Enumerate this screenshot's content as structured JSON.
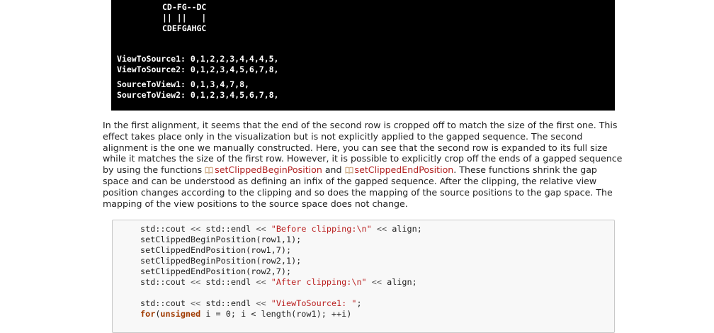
{
  "console": {
    "alignment_lines": [
      "CD-FG--DC",
      "|| ||   |",
      "CDEFGAHGC"
    ],
    "view_to_source": [
      "ViewToSource1: 0,1,2,2,3,4,4,4,5,",
      "ViewToSource2: 0,1,2,3,4,5,6,7,8,"
    ],
    "source_to_view": [
      "SourceToView1: 0,1,3,4,7,8,",
      "SourceToView2: 0,1,2,3,4,5,6,7,8,"
    ]
  },
  "prose": {
    "part1": "In the first alignment, it seems that the end of the second row is cropped off to match the size of the first one. This effect takes place only in the visualization but is not explicitly applied to the gapped sequence. The second alignment is the one we manually constructed. Here, you can see that the second row is expanded to its full size while it matches the size of the first row. However, it is possible to explicitly crop off the ends of a gapped sequence by using the functions ",
    "link1": "setClippedBeginPosition",
    "and": " and ",
    "link2": "setClippedEndPosition",
    "part2": ". These functions shrink the gap space and can be understood as defining an infix of the gapped sequence. After the clipping, the relative view position changes according to the clipping and so does the mapping of the source positions to the gap space. The mapping of the view positions to the source space does not change."
  },
  "code": {
    "l1_a": "std::cout ",
    "l1_op1": "<<",
    "l1_b": " std::endl ",
    "l1_op2": "<<",
    "l1_str": "\"Before clipping:\\n\"",
    "l1_op3": "<<",
    "l1_c": " align;",
    "l2": "setClippedBeginPosition(row1,1);",
    "l3": "setClippedEndPosition(row1,7);",
    "l4": "setClippedBeginPosition(row2,1);",
    "l5": "setClippedEndPosition(row2,7);",
    "l6_a": "std::cout ",
    "l6_op1": "<<",
    "l6_b": " std::endl ",
    "l6_op2": "<<",
    "l6_str": "\"After clipping:\\n\"",
    "l6_op3": "<<",
    "l6_c": " align;",
    "l7_a": "std::cout ",
    "l7_op1": "<<",
    "l7_b": " std::endl ",
    "l7_op2": "<<",
    "l7_str": "\"ViewToSource1: \"",
    "l7_c": ";",
    "l8_kw1": "for",
    "l8_a": "(",
    "l8_kw2": "unsigned",
    "l8_b": " i = 0; i < length(row1); ++i)"
  }
}
